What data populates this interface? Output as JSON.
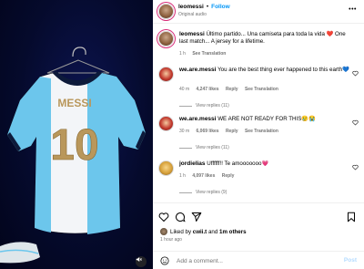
{
  "post": {
    "username": "leomessi",
    "follow_label": "Follow",
    "audio": "Original audio",
    "more": "•••"
  },
  "caption": {
    "username": "leomessi",
    "text": "Último partido... Una camiseta para toda la vida ❤️ One last match... A jersey for a lifetime.",
    "time": "1 h",
    "translation": "See Translation"
  },
  "comments": [
    {
      "username": "we.are.messi",
      "text": "You are the best thing ever happened to this earth💙",
      "time": "40 m",
      "likes": "4,247 likes",
      "reply": "Reply",
      "translation": "See Translation",
      "view_replies": "View replies (11)"
    },
    {
      "username": "we.are.messi",
      "text": "WE ARE NOT READY FOR THIS😢😭",
      "time": "30 m",
      "likes": "6,069 likes",
      "reply": "Reply",
      "translation": "See Translation",
      "view_replies": "View replies (11)"
    },
    {
      "username": "jordielias",
      "text": "Uffffff!! Te amooooooo💗",
      "time": "1 h",
      "likes": "4,097 likes",
      "reply": "Reply",
      "translation": "",
      "view_replies": "View replies (9)"
    }
  ],
  "footer": {
    "liked_prefix": "Liked by ",
    "liked_user": "cwii.t",
    "liked_and": " and ",
    "liked_others": "1m others",
    "time_ago": "1 hour ago",
    "comment_placeholder": "Add a comment...",
    "post_label": "Post"
  },
  "jersey": {
    "name": "MESSI",
    "number": "10"
  },
  "icons": {
    "heart": "heart-icon",
    "comment": "comment-icon",
    "share": "share-icon",
    "bookmark": "bookmark-icon",
    "emoji": "emoji-icon",
    "mute": "mute-icon",
    "more": "more-icon"
  },
  "colors": {
    "accent": "#0095f6",
    "jersey_blue": "#6cc6ec",
    "jersey_gold": "#b9975b",
    "background_dark": "#050a2c"
  }
}
